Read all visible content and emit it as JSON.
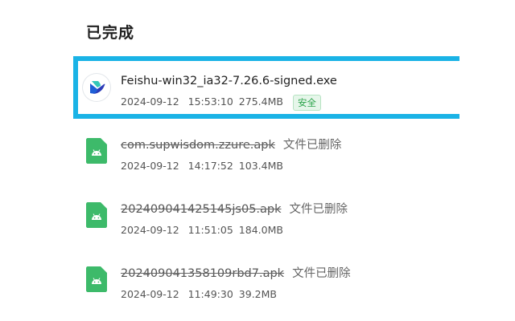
{
  "section": {
    "title": "已完成"
  },
  "downloads": [
    {
      "name": "Feishu-win32_ia32-7.26.6-signed.exe",
      "date": "2024-09-12",
      "time": "15:53:10",
      "size": "275.4MB",
      "badge": "安全",
      "icon": "feishu-app-icon",
      "deleted": false
    },
    {
      "name": "com.supwisdom.zzure.apk",
      "status": "文件已删除",
      "date": "2024-09-12",
      "time": "14:17:52",
      "size": "103.4MB",
      "icon": "android-apk-icon",
      "deleted": true
    },
    {
      "name": "202409041425145js05.apk",
      "status": "文件已删除",
      "date": "2024-09-12",
      "time": "11:51:05",
      "size": "184.0MB",
      "icon": "android-apk-icon",
      "deleted": true
    },
    {
      "name": "202409041358109rbd7.apk",
      "status": "文件已删除",
      "date": "2024-09-12",
      "time": "11:49:30",
      "size": "39.2MB",
      "icon": "android-apk-icon",
      "deleted": true
    }
  ],
  "colors": {
    "highlight": "#1ab3e6",
    "apk_icon": "#3dba6a",
    "safe_badge": "#2aa34a"
  }
}
